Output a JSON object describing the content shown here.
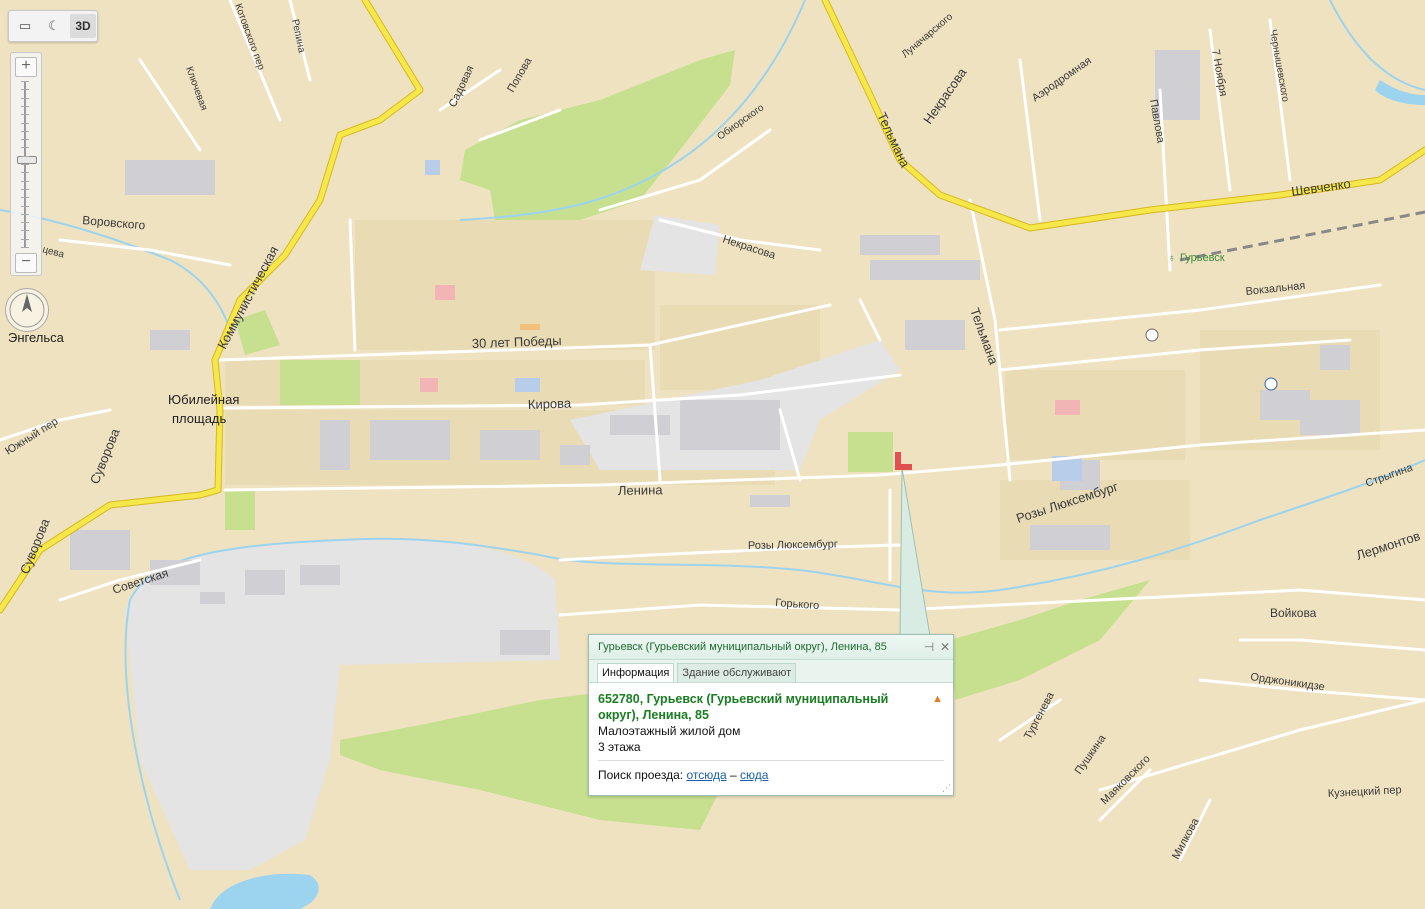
{
  "toolbar": {
    "ruler_icon": "ruler-icon",
    "night_icon": "moon-icon",
    "label_3d": "3D"
  },
  "zoom": {
    "plus": "+",
    "minus": "−",
    "level_fraction": 0.55
  },
  "streets": {
    "vorovskogo": "Воровского",
    "kommunisticheskaya": "Коммунистическая",
    "pobedy": "30 лет Победы",
    "kirova": "Кирова",
    "lenina": "Ленина",
    "rozy_1": "Розы Люксембург",
    "rozy_2": "Розы Люксембург",
    "sovetskaya": "Советская",
    "suvorova_1": "Суворова",
    "suvorova_2": "Суворова",
    "yuzhny": "Южный пер",
    "gorkogo": "Горького",
    "nekrasova_1": "Некрасова",
    "nekrasova_2": "Некрасова",
    "telmana_1": "Тельмана",
    "telmana_2": "Тельмана",
    "shevchenko": "Шевченко",
    "vokzalnaya": "Вокзальная",
    "aerodromnaya": "Аэродромная",
    "lunacharskogo": "Луначарского",
    "pavlova": "Павлова",
    "noyabrya": "7 Ноября",
    "chernyshevskogo": "Чернышевского",
    "oborskogo": "Обиорского",
    "sadovaya": "Садовая",
    "popova": "Попова",
    "kotovskogo": "Котовского пер",
    "repina": "Репина",
    "klyuchevaya": "Ключевая",
    "engelsa": "Энгельса",
    "tseva": "цева",
    "strygina": "Стрыгина",
    "lermontov": "Лермонтов",
    "voykova": "Войкова",
    "ordzhonikidze": "Орджоникидзе",
    "turgeneva": "Тургенева",
    "pushkina": "Пушкина",
    "mayakovskogo": "Маяковского",
    "milkova": "Милкова",
    "kuznetsky": "Кузнецкий пер"
  },
  "places": {
    "square_line1": "Юбилейная",
    "square_line2": "площадь",
    "station": "Гурьевск"
  },
  "balloon": {
    "title": "Гурьевск (Гурьевский муниципальный округ), Ленина, 85",
    "pin_icon": "pin-icon",
    "close_icon": "close-icon",
    "tabs": [
      "Информация",
      "Здание обслуживают"
    ],
    "address": "652780, Гурьевск (Гурьевский муниципальный округ), Ленина, 85",
    "building_type": "Малоэтажный жилой дом",
    "floors": "3 этажа",
    "route_label": "Поиск проезда:",
    "route_from": "отсюда",
    "route_dash": "–",
    "route_to": "сюда"
  },
  "colors": {
    "land": "#efe2c0",
    "block": "#e7d9b2",
    "road": "#ffffff",
    "main_road": "#f6e84a",
    "main_road_edge": "#d6b820",
    "park": "#c6e08f",
    "water": "#9cd3ee",
    "industrial": "#e6e6e6",
    "building": "#cfcfd4",
    "accent_green": "#1b7d22"
  }
}
